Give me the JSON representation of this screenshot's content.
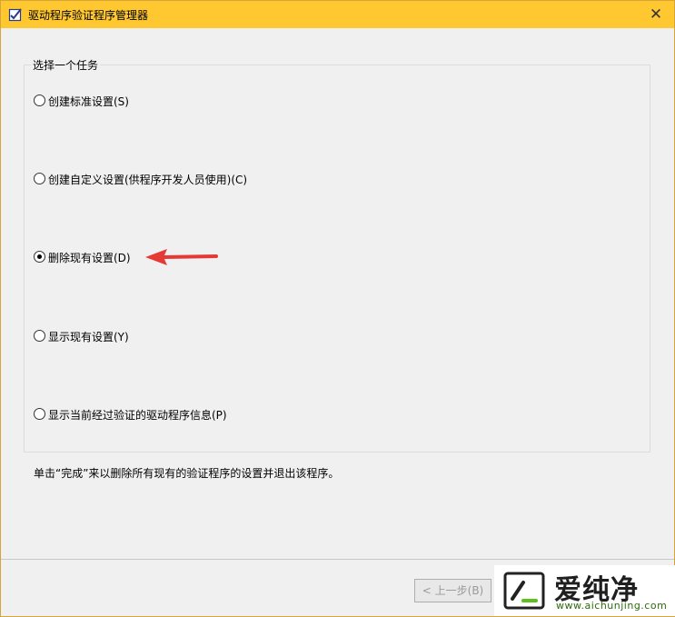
{
  "window": {
    "title": "驱动程序验证程序管理器",
    "close_glyph": "✕",
    "accent_color": "#ffc831"
  },
  "task_group": {
    "title": "选择一个任务",
    "options": [
      {
        "label": "创建标准设置(S)",
        "checked": false
      },
      {
        "label": "创建自定义设置(供程序开发人员使用)(C)",
        "checked": false
      },
      {
        "label": "删除现有设置(D)",
        "checked": true
      },
      {
        "label": "显示现有设置(Y)",
        "checked": false
      },
      {
        "label": "显示当前经过验证的驱动程序信息(P)",
        "checked": false
      }
    ]
  },
  "hint": "单击“完成”来以删除所有现有的验证程序的设置并退出该程序。",
  "buttons": {
    "back_label": "< 上一步(B)"
  },
  "watermark": {
    "title": "爱纯净",
    "url": "www.aichunjing.com"
  },
  "annotation": {
    "arrow_color": "#e53935"
  }
}
